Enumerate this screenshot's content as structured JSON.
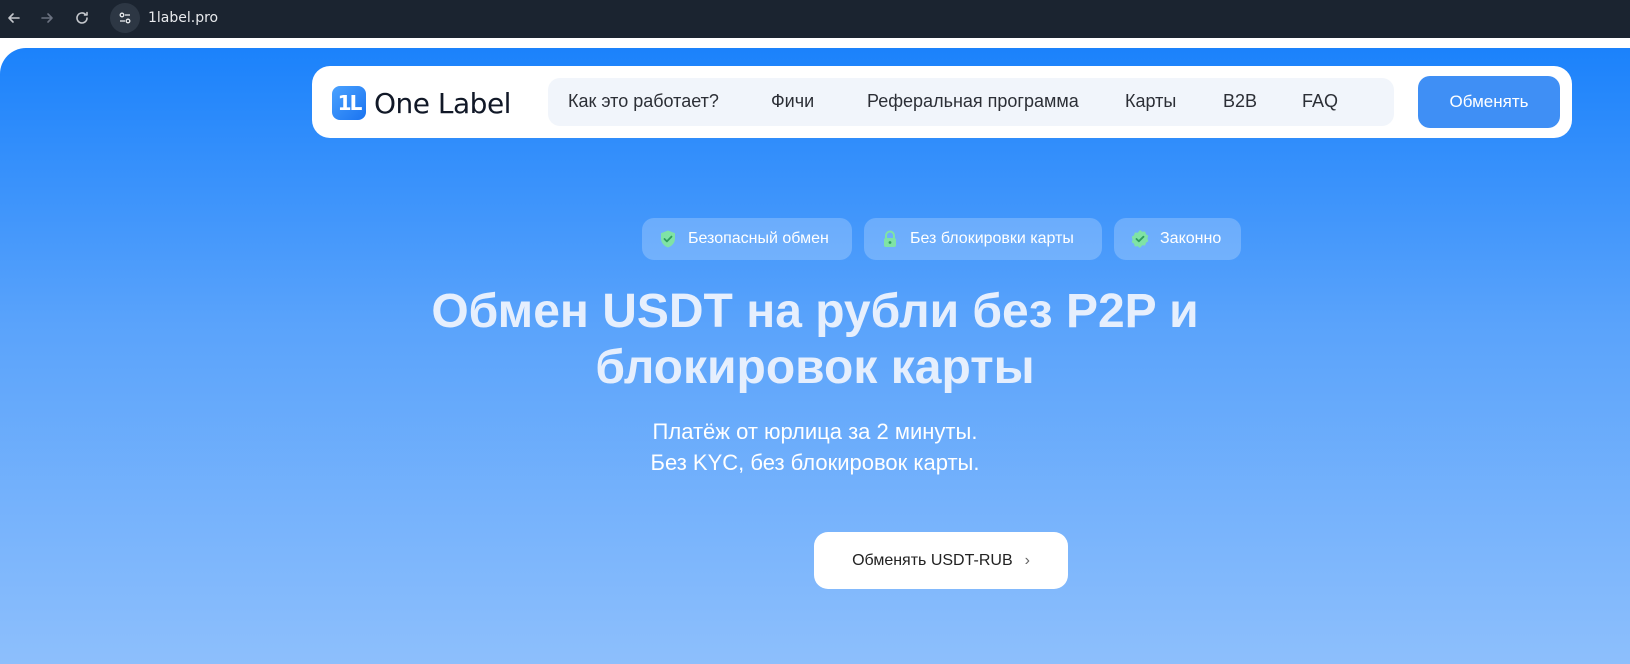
{
  "browser": {
    "url": "1label.pro"
  },
  "header": {
    "logo_text": "One Label",
    "logo_mark": "1L",
    "nav": [
      {
        "label": "Как это работает?"
      },
      {
        "label": "Фичи"
      },
      {
        "label": "Реферальная программа"
      },
      {
        "label": "Карты"
      },
      {
        "label": "B2B"
      },
      {
        "label": "FAQ"
      }
    ],
    "cta_label": "Обменять"
  },
  "badges": [
    {
      "label": "Безопасный обмен",
      "icon": "shield-check-icon"
    },
    {
      "label": "Без блокировки карты",
      "icon": "lock-icon"
    },
    {
      "label": "Законно",
      "icon": "verified-badge-icon"
    }
  ],
  "hero": {
    "title_line1": "Обмен USDT на рубли без P2P и",
    "title_line2": "блокировок карты",
    "subtitle_line1": "Платёж от юрлица за 2 минуты.",
    "subtitle_line2": "Без KYC, без блокировок карты.",
    "cta_label": "Обменять USDT-RUB",
    "cta_chevron": "›"
  },
  "colors": {
    "brand_blue": "#3f8ff5",
    "gradient_top": "#1b82fb",
    "gradient_bottom": "#8dbffc",
    "badge_green": "#5ad58a"
  }
}
